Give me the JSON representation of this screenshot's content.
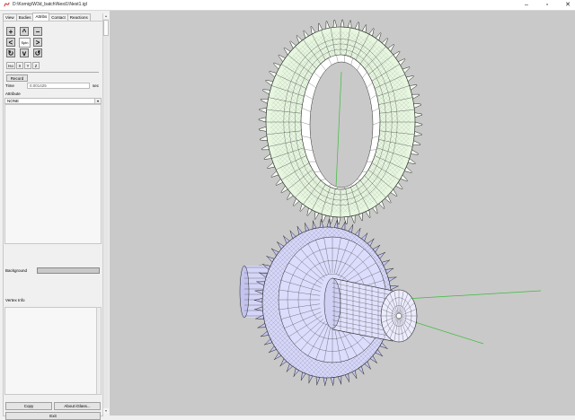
{
  "window": {
    "title": "D:\\Kornig\\W3d_batch\\Nest1\\Nest1.igl",
    "minimize_label": "–",
    "maximize_label": "▫",
    "close_label": "✕",
    "app_icon": "app-logo-icon"
  },
  "tabs": [
    {
      "label": "View"
    },
    {
      "label": "Bodies"
    },
    {
      "label": "Attribs"
    },
    {
      "label": "Contact"
    },
    {
      "label": "Reactions"
    }
  ],
  "nav": {
    "zoom_in": "+",
    "up": "^",
    "zoom_out": "−",
    "left": "<",
    "spin_label": "Spin",
    "right": ">",
    "rot_cw": "↻",
    "down": "v",
    "rot_ccw": "↺"
  },
  "view_buttons": [
    {
      "label": "Iso"
    },
    {
      "label": "X"
    },
    {
      "label": "Y"
    },
    {
      "label": "Z"
    }
  ],
  "record_label": "Record",
  "time": {
    "label": "Time",
    "value": "0.001425",
    "unit": "sec"
  },
  "attribute": {
    "label": "Attribute",
    "selected": "NONE"
  },
  "background_label": "Background",
  "background_color": "#c9c9c9",
  "vertex_info_label": "Vertex Info",
  "copy_label": "Copy",
  "about_label": "About iGlass...",
  "exit_label": "Exit",
  "colors": {
    "upper_gear_fill": "#eaf8e4",
    "lower_gear_fill": "#d9d9fb",
    "axis_line": "#3cbc3c",
    "mesh_line": "#333333"
  }
}
